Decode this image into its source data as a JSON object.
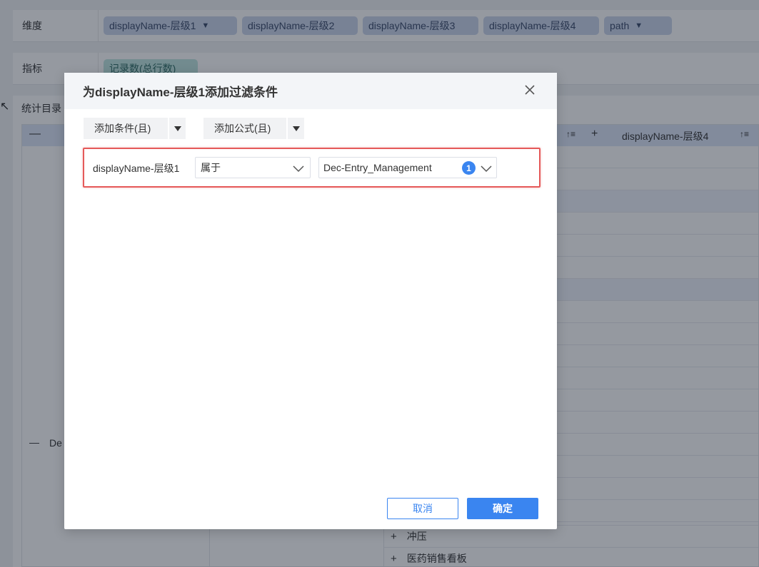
{
  "background": {
    "dimension_label": "维度",
    "dimension_pills": [
      {
        "label": "displayName-层级1",
        "filter_icon": true
      },
      {
        "label": "displayName-层级2"
      },
      {
        "label": "displayName-层级3"
      },
      {
        "label": "displayName-层级4"
      },
      {
        "label": "path",
        "filter_icon": true
      }
    ],
    "metric_label": "指标",
    "metric_pill": "记录数(总行数)",
    "stat_label": "统计目录",
    "header_column_4": "displayName-层级4",
    "tree_node_partial": "De",
    "list_items": [
      "冲压",
      "医药销售看板"
    ]
  },
  "dialog": {
    "title": "为displayName-层级1添加过滤条件",
    "add_condition_label": "添加条件(且)",
    "add_formula_label": "添加公式(且)",
    "condition": {
      "field": "displayName-层级1",
      "operator": "属于",
      "value": "Dec-Entry_Management",
      "selected_count": "1"
    },
    "cancel_label": "取消",
    "confirm_label": "确定"
  },
  "colors": {
    "primary": "#3a85f0",
    "highlight_border": "#e55a5a",
    "dimension_pill": "#cad5ec",
    "metric_pill": "#bfe6e0"
  }
}
